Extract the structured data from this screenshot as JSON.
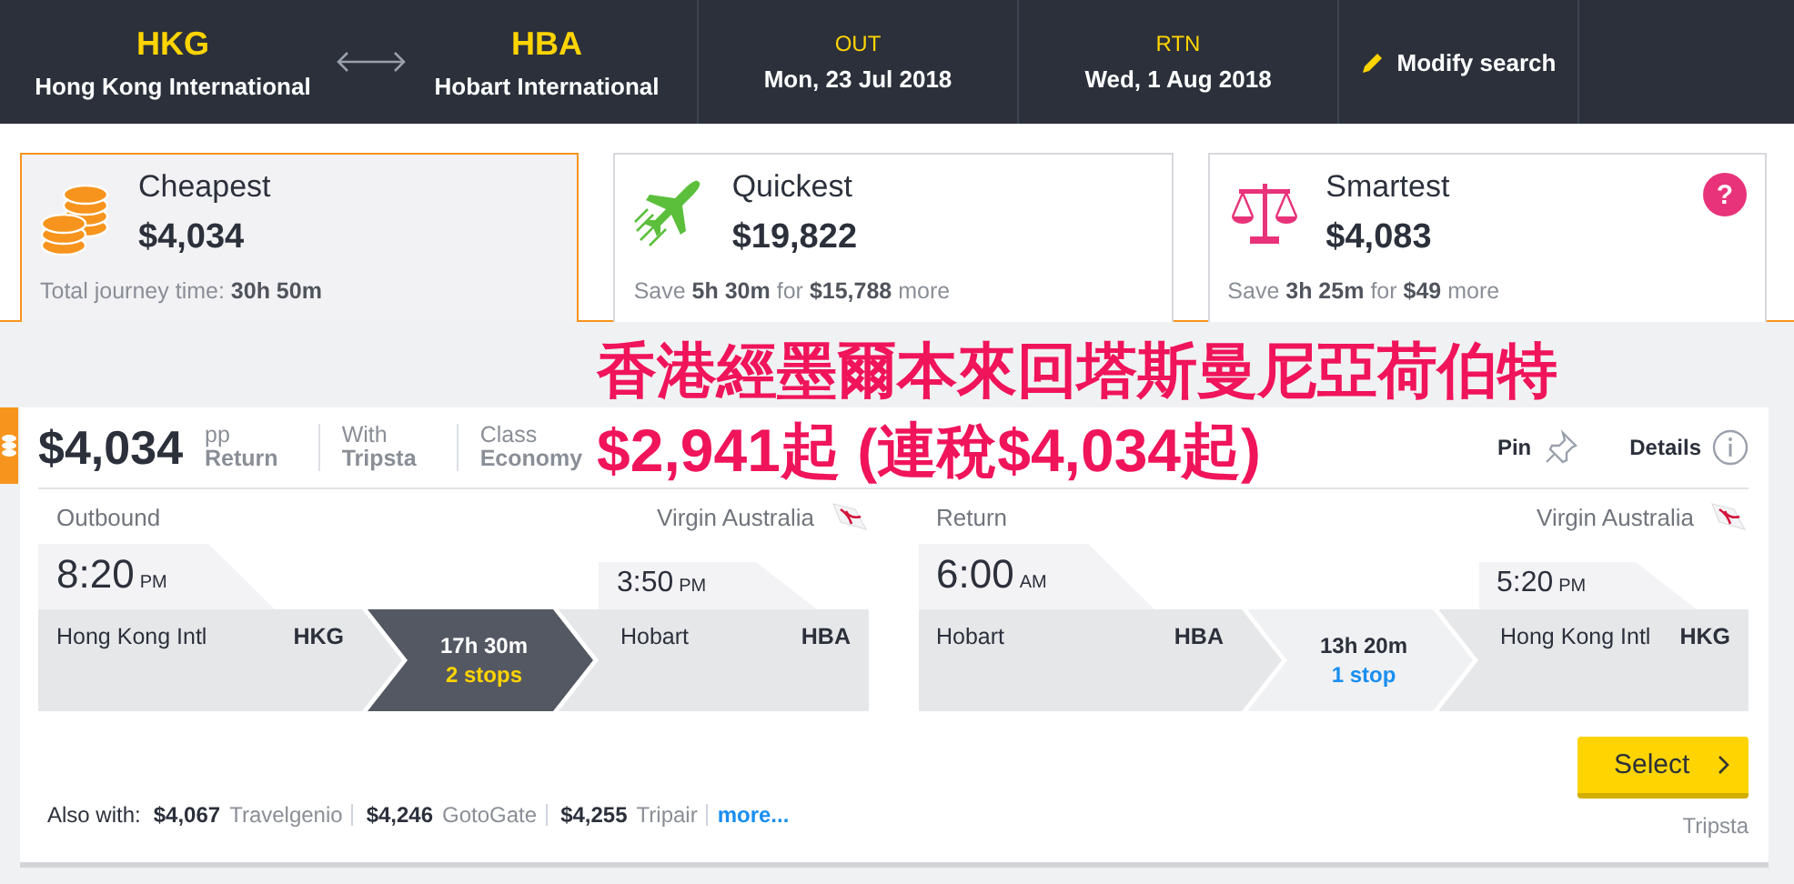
{
  "header": {
    "origin": {
      "code": "HKG",
      "name": "Hong Kong International"
    },
    "destination": {
      "code": "HBA",
      "name": "Hobart International"
    },
    "dates": [
      {
        "label": "OUT",
        "date": "Mon, 23 Jul 2018"
      },
      {
        "label": "RTN",
        "date": "Wed, 1 Aug 2018"
      }
    ],
    "modify": "Modify search"
  },
  "sort_tabs": [
    {
      "kind": "coins",
      "label": "Cheapest",
      "price": "$4,034",
      "note": "Total journey time: **30h 50m**",
      "selected": true
    },
    {
      "kind": "plane",
      "label": "Quickest",
      "price": "$19,822",
      "note": "Save **5h 30m** for **$15,788** more",
      "selected": false
    },
    {
      "kind": "scales",
      "label": "Smartest",
      "price": "$4,083",
      "note": "Save **3h 25m** for **$49** more",
      "selected": false,
      "help": "?"
    }
  ],
  "result": {
    "price": "$4,034",
    "pp": "pp",
    "fare_type": "Return",
    "with_label": "With",
    "with_value": "Tripsta",
    "class_label": "Class",
    "class_value": "Economy",
    "pin": "Pin",
    "details": "Details",
    "legs": [
      {
        "label": "Outbound",
        "airline": "Virgin Australia",
        "dep_time": "8:20",
        "dep_ampm": "PM",
        "arr_time": "3:50",
        "arr_ampm": "PM",
        "dep_city": "Hong Kong Intl",
        "dep_code": "HKG",
        "arr_city": "Hobart",
        "arr_code": "HBA",
        "duration": "17h 30m",
        "stops": "2 stops",
        "highlighted": true
      },
      {
        "label": "Return",
        "airline": "Virgin Australia",
        "dep_time": "6:00",
        "dep_ampm": "AM",
        "arr_time": "5:20",
        "arr_ampm": "PM",
        "dep_city": "Hobart",
        "dep_code": "HBA",
        "arr_city": "Hong Kong Intl",
        "arr_code": "HKG",
        "duration": "13h 20m",
        "stops": "1 stop",
        "highlighted": false
      }
    ],
    "also_label": "Also with:",
    "offers": [
      {
        "price": "$4,067",
        "agent": "Travelgenio"
      },
      {
        "price": "$4,246",
        "agent": "GotoGate"
      },
      {
        "price": "$4,255",
        "agent": "Tripair"
      }
    ],
    "more": "more...",
    "select": "Select",
    "agent": "Tripsta"
  },
  "overlay": [
    "香港經墨爾本來回塔斯曼尼亞荷伯特",
    "$2,941起 (連稅$4,034起)"
  ]
}
